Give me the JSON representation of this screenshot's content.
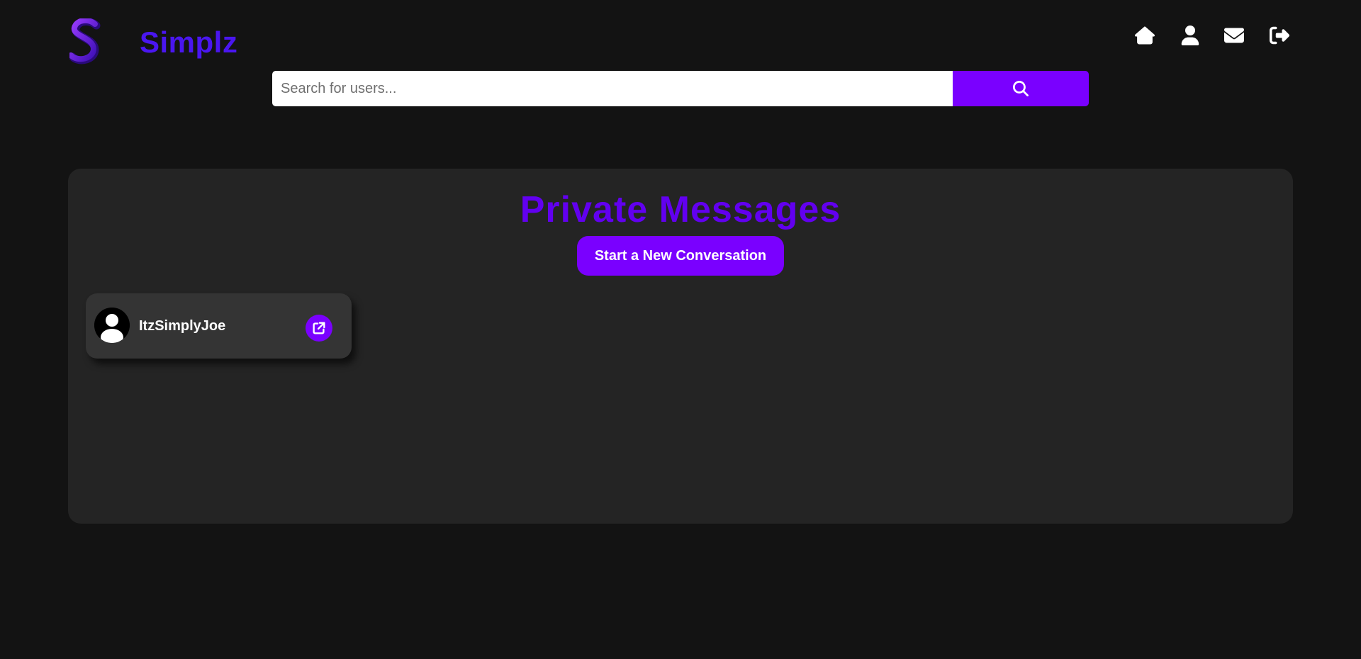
{
  "header": {
    "brand": "Simplz",
    "logo_icon": "stylized-s-logo",
    "nav": [
      {
        "name": "home",
        "icon": "home-icon"
      },
      {
        "name": "profile",
        "icon": "user-icon"
      },
      {
        "name": "messages",
        "icon": "envelope-icon"
      },
      {
        "name": "logout",
        "icon": "sign-out-icon"
      }
    ]
  },
  "search": {
    "placeholder": "Search for users...",
    "value": "",
    "button_icon": "search-icon"
  },
  "main": {
    "title": "Private Messages",
    "new_conversation_label": "Start a New Conversation",
    "conversations": [
      {
        "username": "ItzSimplyJoe",
        "avatar_icon": "default-avatar-icon",
        "action_icon": "external-link-icon"
      }
    ]
  },
  "colors": {
    "page_bg": "#131313",
    "panel_bg": "#242424",
    "card_bg": "#343434",
    "brand_text": "#4a16f0",
    "title_text": "#6200f0",
    "accent": "#7a00ff",
    "nav_icon": "#ffffff"
  }
}
